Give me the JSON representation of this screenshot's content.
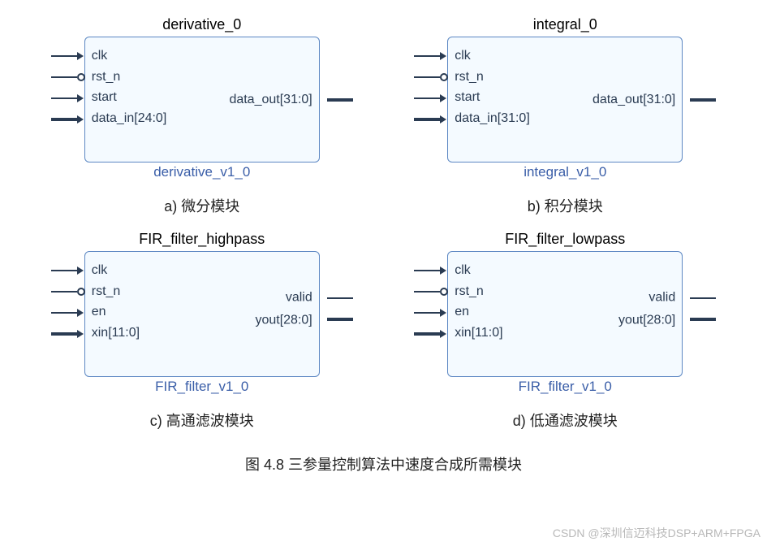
{
  "blocks": [
    {
      "title": "derivative_0",
      "footer": "derivative_v1_0",
      "inputs": [
        "clk",
        "rst_n",
        "start",
        "data_in[24:0]"
      ],
      "outputs": [
        "data_out[31:0]"
      ],
      "caption": "a)  微分模块"
    },
    {
      "title": "integral_0",
      "footer": "integral_v1_0",
      "inputs": [
        "clk",
        "rst_n",
        "start",
        "data_in[31:0]"
      ],
      "outputs": [
        "data_out[31:0]"
      ],
      "caption": "b)  积分模块"
    },
    {
      "title": "FIR_filter_highpass",
      "footer": "FIR_filter_v1_0",
      "inputs": [
        "clk",
        "rst_n",
        "en",
        "xin[11:0]"
      ],
      "outputs": [
        "valid",
        "yout[28:0]"
      ],
      "caption": "c)  高通滤波模块"
    },
    {
      "title": "FIR_filter_lowpass",
      "footer": "FIR_filter_v1_0",
      "inputs": [
        "clk",
        "rst_n",
        "en",
        "xin[11:0]"
      ],
      "outputs": [
        "valid",
        "yout[28:0]"
      ],
      "caption": "d)  低通滤波模块"
    }
  ],
  "figure_caption": "图 4.8  三参量控制算法中速度合成所需模块",
  "watermark": "CSDN @深圳信迈科技DSP+ARM+FPGA"
}
